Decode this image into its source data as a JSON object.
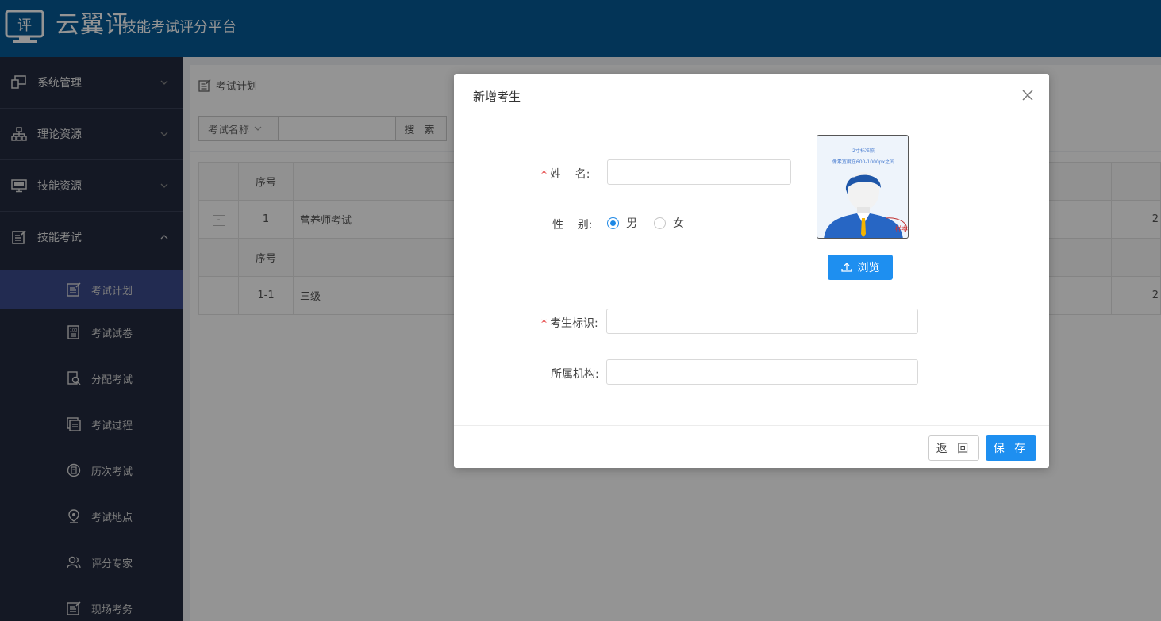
{
  "header": {
    "logo_glyph": "评",
    "brand": "云翼评",
    "subtitle": "技能考试评分平台"
  },
  "sidebar": {
    "groups": [
      {
        "label": "系统管理",
        "icon": "monitor-icon",
        "expanded": false
      },
      {
        "label": "理论资源",
        "icon": "sitemap-icon",
        "expanded": false
      },
      {
        "label": "技能资源",
        "icon": "screen-icon",
        "expanded": false
      },
      {
        "label": "技能考试",
        "icon": "edit-icon",
        "expanded": true
      }
    ],
    "sub_items": [
      {
        "label": "考试计划",
        "icon": "edit-doc-icon",
        "active": true
      },
      {
        "label": "考试试卷",
        "icon": "exam-paper-icon",
        "active": false
      },
      {
        "label": "分配考试",
        "icon": "assign-search-icon",
        "active": false
      },
      {
        "label": "考试过程",
        "icon": "process-icon",
        "active": false
      },
      {
        "label": "历次考试",
        "icon": "history-icon",
        "active": false
      },
      {
        "label": "考试地点",
        "icon": "location-icon",
        "active": false
      },
      {
        "label": "评分专家",
        "icon": "experts-icon",
        "active": false
      },
      {
        "label": "现场考务",
        "icon": "onsite-icon",
        "active": false
      }
    ]
  },
  "breadcrumb": {
    "title": "考试计划"
  },
  "search": {
    "field_label": "考试名称",
    "value": "",
    "button": "搜 索"
  },
  "table": {
    "header": {
      "seq": "序号"
    },
    "rows": [
      {
        "expand": "-",
        "seq": "1",
        "name": "营养师考试",
        "tail": "2"
      }
    ],
    "sub_header": {
      "seq": "序号"
    },
    "sub_rows": [
      {
        "seq": "1-1",
        "name": "三级",
        "tail": "2"
      }
    ]
  },
  "modal": {
    "title": "新增考生",
    "fields": {
      "name_label": "姓    名:",
      "name_value": "",
      "gender_label": "性    别:",
      "gender_options": [
        "男",
        "女"
      ],
      "gender_selected": "男",
      "examinee_id_label": "考生标识:",
      "examinee_id_value": "",
      "org_label": "所属机构:",
      "org_value": ""
    },
    "photo": {
      "line1": "2寸标准照",
      "line2": "像素宽度在600-1000px之间",
      "stamp": "样本"
    },
    "browse_button": "浏览",
    "back_button": "返 回",
    "save_button": "保 存"
  },
  "colors": {
    "header_bg": "#065a97",
    "sidebar_bg": "#232a3f",
    "active_item": "#3b4a8c",
    "primary": "#1e8ff0",
    "required": "#e02020"
  }
}
